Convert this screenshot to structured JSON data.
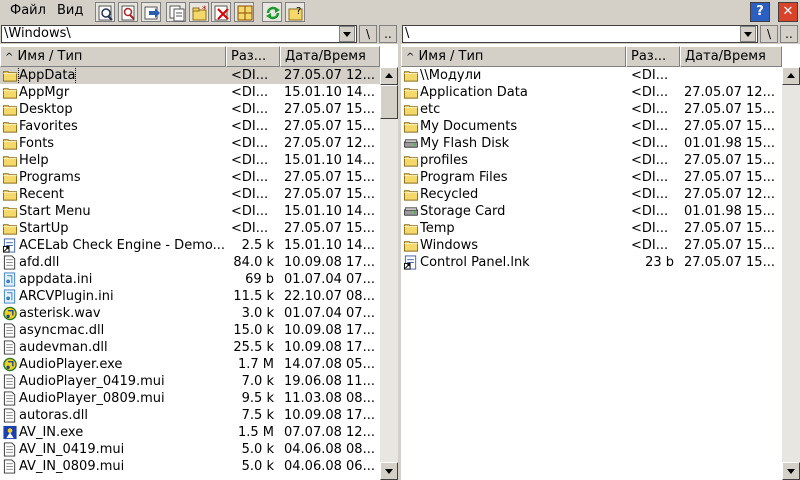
{
  "menu": {
    "file": "Файл",
    "view": "Вид"
  },
  "toolbar_icons": [
    "find-icon",
    "find-file-icon",
    "move-icon",
    "copy-icon",
    "new-folder-icon",
    "delete-icon",
    "split-view-icon",
    "refresh-icon",
    "properties-icon"
  ],
  "window_buttons": {
    "help": "?",
    "close": "✕"
  },
  "left": {
    "path": "\\Windows\\",
    "up_label": "\\",
    "parent_label": "..",
    "columns": {
      "name": "Имя / Тип",
      "size": "Раз...",
      "date": "Дата/Время"
    },
    "rows": [
      {
        "name": "AppData",
        "size": "<DI...",
        "date": "27.05.07 12...",
        "icon": "folder-icon",
        "selected": true
      },
      {
        "name": "AppMgr",
        "size": "<DI...",
        "date": "15.01.10 14...",
        "icon": "folder-icon"
      },
      {
        "name": "Desktop",
        "size": "<DI...",
        "date": "27.05.07 15...",
        "icon": "folder-icon"
      },
      {
        "name": "Favorites",
        "size": "<DI...",
        "date": "27.05.07 15...",
        "icon": "folder-icon"
      },
      {
        "name": "Fonts",
        "size": "<DI...",
        "date": "27.05.07 12...",
        "icon": "folder-icon"
      },
      {
        "name": "Help",
        "size": "<DI...",
        "date": "15.01.10 14...",
        "icon": "folder-icon"
      },
      {
        "name": "Programs",
        "size": "<DI...",
        "date": "27.05.07 15...",
        "icon": "folder-icon"
      },
      {
        "name": "Recent",
        "size": "<DI...",
        "date": "27.05.07 15...",
        "icon": "folder-icon"
      },
      {
        "name": "Start Menu",
        "size": "<DI...",
        "date": "15.01.10 14...",
        "icon": "folder-icon"
      },
      {
        "name": "StartUp",
        "size": "<DI...",
        "date": "27.05.07 15...",
        "icon": "folder-icon"
      },
      {
        "name": "ACELab Check Engine - Demo....",
        "size": "2.5 k",
        "date": "15.01.10 14...",
        "icon": "shortcut-icon"
      },
      {
        "name": "afd.dll",
        "size": "84.0 k",
        "date": "10.09.08 17...",
        "icon": "file-icon"
      },
      {
        "name": "appdata.ini",
        "size": "69 b",
        "date": "01.07.04 07...",
        "icon": "ini-icon"
      },
      {
        "name": "ARCVPlugin.ini",
        "size": "11.5 k",
        "date": "22.10.07 08...",
        "icon": "ini-icon"
      },
      {
        "name": "asterisk.wav",
        "size": "3.0 k",
        "date": "01.07.04 07...",
        "icon": "audio-icon"
      },
      {
        "name": "asyncmac.dll",
        "size": "15.0 k",
        "date": "10.09.08 17...",
        "icon": "file-icon"
      },
      {
        "name": "audevman.dll",
        "size": "25.5 k",
        "date": "10.09.08 17...",
        "icon": "file-icon"
      },
      {
        "name": "AudioPlayer.exe",
        "size": "1.7 M",
        "date": "14.07.08 05...",
        "icon": "audio-icon"
      },
      {
        "name": "AudioPlayer_0419.mui",
        "size": "7.0 k",
        "date": "19.06.08 11...",
        "icon": "file-icon"
      },
      {
        "name": "AudioPlayer_0809.mui",
        "size": "9.5 k",
        "date": "11.03.08 08...",
        "icon": "file-icon"
      },
      {
        "name": "autoras.dll",
        "size": "7.5 k",
        "date": "10.09.08 17...",
        "icon": "file-icon"
      },
      {
        "name": "AV_IN.exe",
        "size": "1.5 M",
        "date": "07.07.08 12...",
        "icon": "exe-icon"
      },
      {
        "name": "AV_IN_0419.mui",
        "size": "5.0 k",
        "date": "04.06.08 08...",
        "icon": "file-icon"
      },
      {
        "name": "AV_IN_0809.mui",
        "size": "5.0 k",
        "date": "04.06.08 06...",
        "icon": "file-icon"
      }
    ]
  },
  "right": {
    "path": "\\",
    "up_label": "\\",
    "parent_label": "..",
    "columns": {
      "name": "Имя / Тип",
      "size": "Раз...",
      "date": "Дата/Время"
    },
    "rows": [
      {
        "name": "\\\\Модули",
        "size": "<DI...",
        "date": "",
        "icon": "folder-icon"
      },
      {
        "name": "Application Data",
        "size": "<DI...",
        "date": "27.05.07 12...",
        "icon": "folder-icon"
      },
      {
        "name": "etc",
        "size": "<DI...",
        "date": "27.05.07 15...",
        "icon": "folder-icon"
      },
      {
        "name": "My Documents",
        "size": "<DI...",
        "date": "27.05.07 15...",
        "icon": "folder-icon"
      },
      {
        "name": "My Flash Disk",
        "size": "<DI...",
        "date": "01.01.98 15...",
        "icon": "disk-icon"
      },
      {
        "name": "profiles",
        "size": "<DI...",
        "date": "27.05.07 15...",
        "icon": "folder-icon"
      },
      {
        "name": "Program Files",
        "size": "<DI...",
        "date": "27.05.07 15...",
        "icon": "folder-icon"
      },
      {
        "name": "Recycled",
        "size": "<DI...",
        "date": "27.05.07 12...",
        "icon": "folder-icon"
      },
      {
        "name": "Storage Card",
        "size": "<DI...",
        "date": "01.01.98 15...",
        "icon": "disk-icon"
      },
      {
        "name": "Temp",
        "size": "<DI...",
        "date": "27.05.07 15...",
        "icon": "folder-icon"
      },
      {
        "name": "Windows",
        "size": "<DI...",
        "date": "27.05.07 15...",
        "icon": "folder-icon"
      },
      {
        "name": "Control Panel.lnk",
        "size": "23 b",
        "date": "27.05.07 15...",
        "icon": "shortcut-icon"
      }
    ]
  },
  "colors": {
    "folder": "#f5d86a",
    "selection": "#d4d0c8",
    "help_button": "#2b5fc1",
    "close_button": "#d9432a"
  }
}
